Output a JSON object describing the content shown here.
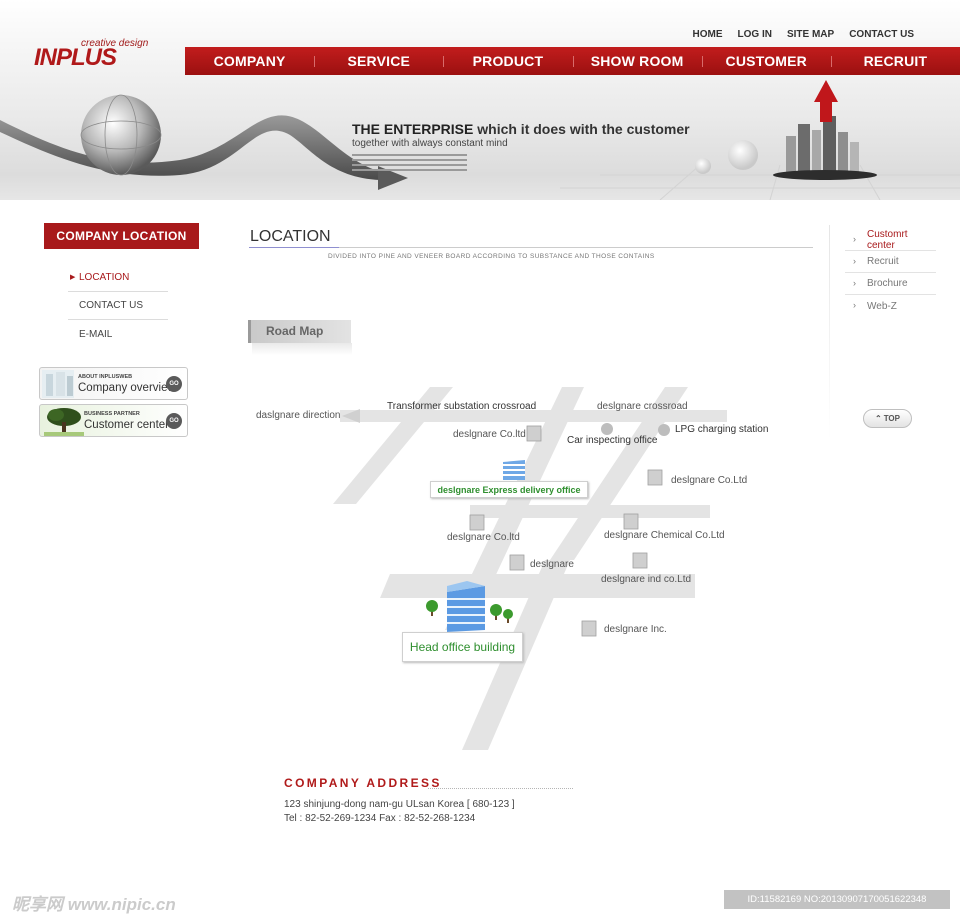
{
  "brand": {
    "tagline": "creative design",
    "name": "INPLUS"
  },
  "top_links": [
    "HOME",
    "LOG IN",
    "SITE MAP",
    "CONTACT US"
  ],
  "main_nav": [
    "COMPANY",
    "SERVICE",
    "PRODUCT",
    "SHOW ROOM",
    "CUSTOMER",
    "RECRUIT"
  ],
  "banner": {
    "headline_bold": "THE ENTERPRISE",
    "headline_rest": " which it does with the customer",
    "subline": "together with always constant mind"
  },
  "left": {
    "title": "COMPANY LOCATION",
    "menu": [
      {
        "label": "LOCATION",
        "active": true
      },
      {
        "label": "CONTACT US",
        "active": false
      },
      {
        "label": "E-MAIL",
        "active": false
      }
    ],
    "promos": [
      {
        "small": "ABOUT INPLUSWEB",
        "big": "Company overview",
        "go": "GO"
      },
      {
        "small": "BUSINESS PARTNER",
        "big": "Customer center",
        "go": "GO"
      }
    ]
  },
  "content": {
    "title": "LOCATION",
    "subtitle": "DIVIDED INTO PINE AND VENEER BOARD ACCORDING TO SUBSTANCE AND THOSE CONTAINS",
    "roadmap_tab": "Road Map"
  },
  "map": {
    "direction": "daslgnare direction",
    "crossroad_1": "Transformer substation crossroad",
    "crossroad_2": "deslgnare crossroad",
    "co_ltd_1": "deslgnare Co.ltd",
    "car_office": "Car inspecting office",
    "lpg": "LPG charging station",
    "express": "deslgnare Express delivery office",
    "co_ltd_right": "deslgnare Co.Ltd",
    "co_ltd_2": "deslgnare Co.ltd",
    "chemical": "deslgnare Chemical Co.Ltd",
    "deslgnare": "deslgnare",
    "ind": "deslgnare ind co.Ltd",
    "inc": "deslgnare Inc.",
    "head_office": "Head office building"
  },
  "right": {
    "menu": [
      {
        "label": "Customrt center",
        "active": true
      },
      {
        "label": "Recruit",
        "active": false
      },
      {
        "label": "Brochure",
        "active": false
      },
      {
        "label": "Web-Z",
        "active": false
      }
    ],
    "top_button": "TOP"
  },
  "address": {
    "title": "COMPANY ADDRESS",
    "line1": "123 shinjung-dong nam-gu ULsan Korea [ 680-123 ]",
    "line2": "Tel : 82-52-269-1234  Fax : 82-52-268-1234"
  },
  "watermark": {
    "left": "昵享网 www.nipic.cn",
    "right": "ID:11582169 NO:20130907170051622348"
  },
  "colors": {
    "brand_red": "#a8191b",
    "nav_red": "#b4181a",
    "map_green": "#2f8f2f"
  }
}
